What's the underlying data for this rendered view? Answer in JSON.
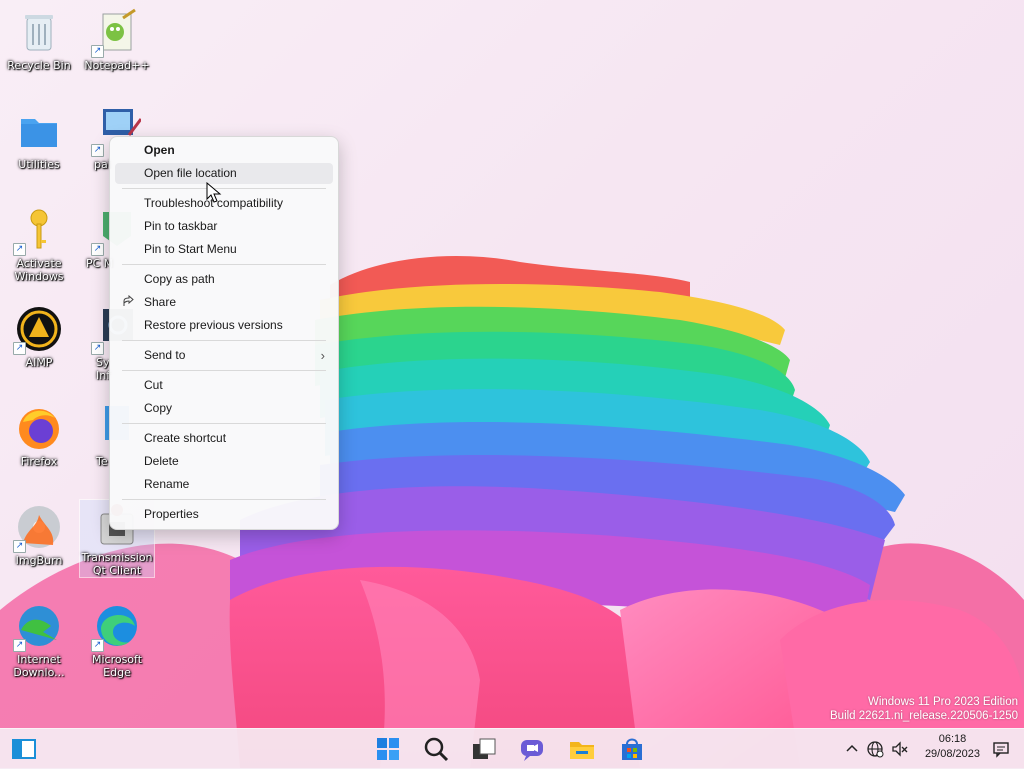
{
  "desktop": {
    "icons": [
      {
        "label": "Recycle Bin"
      },
      {
        "label": "Notepad++"
      },
      {
        "label": "Utilities"
      },
      {
        "label": "pai"
      },
      {
        "label": "Activate Windows"
      },
      {
        "label": "PC M"
      },
      {
        "label": "AIMP"
      },
      {
        "label": "Sy Inf"
      },
      {
        "label": "Firefox"
      },
      {
        "label": "Te"
      },
      {
        "label": "ImgBurn"
      },
      {
        "label": "Transmission Qt Client"
      },
      {
        "label": "Internet Downlo..."
      },
      {
        "label": "Microsoft Edge"
      }
    ]
  },
  "context_menu": {
    "items": [
      {
        "label": "Open"
      },
      {
        "label": "Open file location"
      },
      {
        "label": "Troubleshoot compatibility"
      },
      {
        "label": "Pin to taskbar"
      },
      {
        "label": "Pin to Start Menu"
      },
      {
        "label": "Copy as path"
      },
      {
        "label": "Share"
      },
      {
        "label": "Restore previous versions"
      },
      {
        "label": "Send to"
      },
      {
        "label": "Cut"
      },
      {
        "label": "Copy"
      },
      {
        "label": "Create shortcut"
      },
      {
        "label": "Delete"
      },
      {
        "label": "Rename"
      },
      {
        "label": "Properties"
      }
    ],
    "hovered_item": "Open file location"
  },
  "watermark": {
    "line1": "Windows 11 Pro 2023 Edition",
    "line2": "Build 22621.ni_release.220506-1250"
  },
  "taskbar": {
    "buttons": [
      "widgets-icon",
      "start-icon",
      "search-icon",
      "task-view-icon",
      "chat-icon",
      "file-explorer-icon",
      "store-icon"
    ],
    "tray": [
      "chevron-up-icon",
      "network-icon",
      "volume-muted-icon",
      "notifications-icon"
    ],
    "time": "06:18",
    "date": "29/08/2023"
  },
  "colors": {
    "accent": "#0078d4",
    "menu_bg": "#f9f9fa",
    "menu_hover": "#e9e9ec"
  }
}
